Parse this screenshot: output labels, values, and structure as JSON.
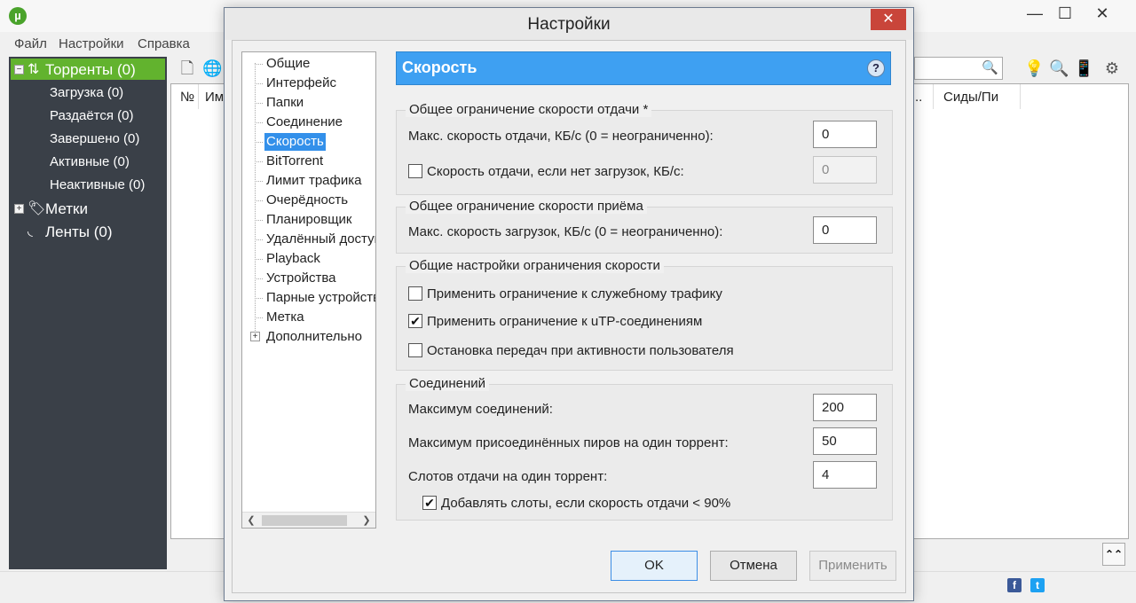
{
  "app": {
    "logo_glyph": "µ",
    "menu": [
      "Файл",
      "Настройки",
      "Справка"
    ],
    "window_controls": {
      "minimize": "—",
      "maximize": "☐",
      "close": "✕"
    }
  },
  "sidebar": {
    "torrents": {
      "label": "Торренты (0)",
      "expander": "−"
    },
    "items": [
      {
        "label": "Загрузка (0)"
      },
      {
        "label": "Раздаётся (0)"
      },
      {
        "label": "Завершено (0)"
      },
      {
        "label": "Активные (0)"
      },
      {
        "label": "Неактивные (0)"
      }
    ],
    "labels": {
      "label": "Метки",
      "expander": "+"
    },
    "feeds": {
      "label": "Ленты (0)"
    }
  },
  "list": {
    "columns": {
      "number": "№",
      "name": "Им",
      "seeds_partial": "..",
      "seeds": "Сиды/Пи"
    }
  },
  "statusbar": {
    "expand_glyph": "⌃⌃"
  },
  "dialog": {
    "title": "Настройки",
    "close_glyph": "✕",
    "tree": {
      "items": [
        "Общие",
        "Интерфейс",
        "Папки",
        "Соединение",
        "Скорость",
        "BitTorrent",
        "Лимит трафика",
        "Очерёдность",
        "Планировщик",
        "Удалённый доступ",
        "Playback",
        "Устройства",
        "Парные устройства",
        "Метка",
        "Дополнительно"
      ],
      "selected": "Скорость",
      "expander": "+"
    },
    "panel": {
      "title": "Скорость",
      "help": "?"
    },
    "upload_group": {
      "title": "Общее ограничение скорости отдачи *",
      "max_label": "Макс. скорость отдачи, КБ/с (0 = неограниченно):",
      "max_value": "0",
      "alt_label": "Скорость отдачи, если нет загрузок, КБ/с:",
      "alt_checked": false,
      "alt_value": "0"
    },
    "download_group": {
      "title": "Общее ограничение скорости приёма",
      "max_label": "Макс. скорость загрузок, КБ/с (0 = неограниченно):",
      "max_value": "0"
    },
    "limits_group": {
      "title": "Общие настройки ограничения скорости",
      "options": [
        {
          "label": "Применить ограничение к служебному трафику",
          "checked": false
        },
        {
          "label": "Применить ограничение к uTP-соединениям",
          "checked": true
        },
        {
          "label": "Остановка передач при активности пользователя",
          "checked": false
        }
      ]
    },
    "connections_group": {
      "title": "Соединений",
      "max_conn_label": "Максимум соединений:",
      "max_conn_value": "200",
      "peers_label": "Максимум присоединённых пиров на один торрент:",
      "peers_value": "50",
      "slots_label": "Слотов отдачи на один торрент:",
      "slots_value": "4",
      "add_slots_label": "Добавлять слоты, если скорость отдачи < 90%",
      "add_slots_checked": true
    },
    "buttons": {
      "ok": "OK",
      "cancel": "Отмена",
      "apply": "Применить"
    }
  }
}
